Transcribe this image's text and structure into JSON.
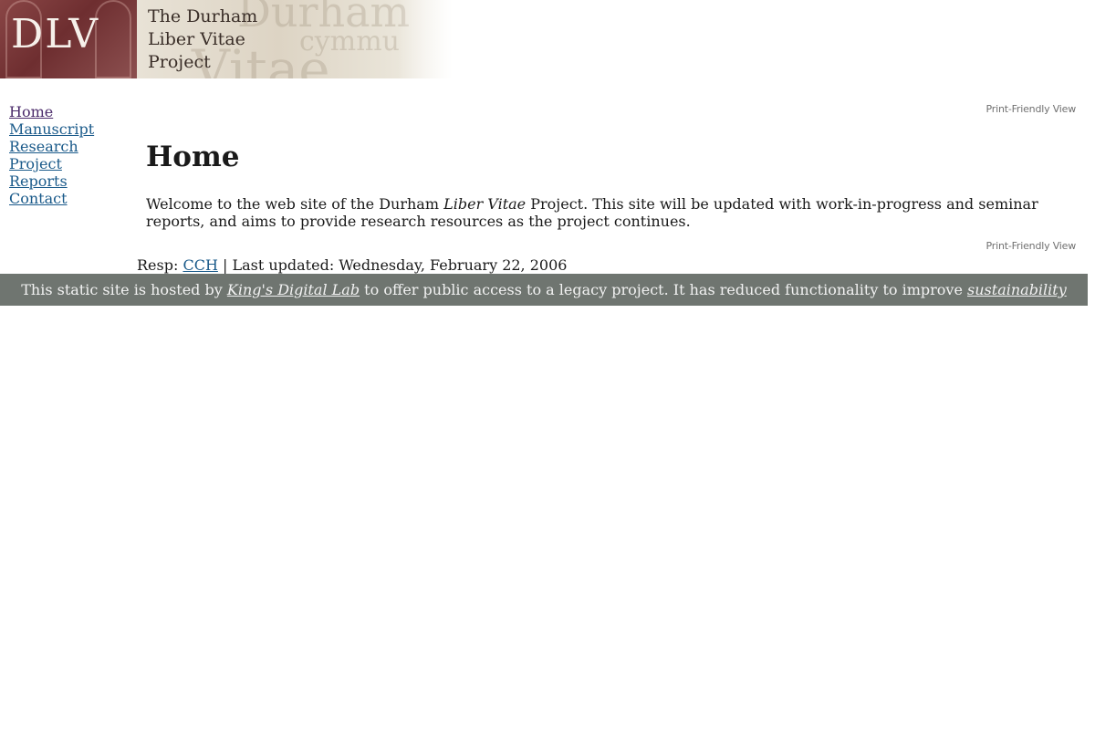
{
  "banner": {
    "logo_text": "DLV",
    "title_lines": [
      "The Durham",
      "Liber Vitae",
      "Project"
    ],
    "background_words": [
      "Durham",
      "Vitae",
      "cymmu"
    ]
  },
  "nav": {
    "items": [
      {
        "label": "Home",
        "visited": true
      },
      {
        "label": "Manuscript",
        "visited": false
      },
      {
        "label": "Research",
        "visited": false
      },
      {
        "label": "Project",
        "visited": false
      },
      {
        "label": "Reports",
        "visited": false
      },
      {
        "label": "Contact",
        "visited": false
      }
    ]
  },
  "print_link": "Print-Friendly View",
  "content": {
    "title": "Home",
    "intro_before": "Welcome to the web site of the Durham ",
    "intro_italic": "Liber Vitae",
    "intro_after": " Project. This site will be updated with work-in-progress and seminar reports, and aims to provide research resources as the project continues."
  },
  "footer": {
    "resp_label": "Resp: ",
    "resp_link": "CCH",
    "separator": " | ",
    "last_updated": "Last updated: Wednesday, February 22, 2006"
  },
  "hosted": {
    "text_before": "This static site is hosted by ",
    "link_text": "King's Digital Lab",
    "text_middle": " to offer public access to a legacy project. It has reduced functionality to improve ",
    "link2_text": "sustainability"
  },
  "colors": {
    "link": "#1a5a8a",
    "visited_link": "#4a2a6a",
    "hosted_banner_bg": "#6f7570",
    "logo_bg": "#7a3a3c"
  }
}
